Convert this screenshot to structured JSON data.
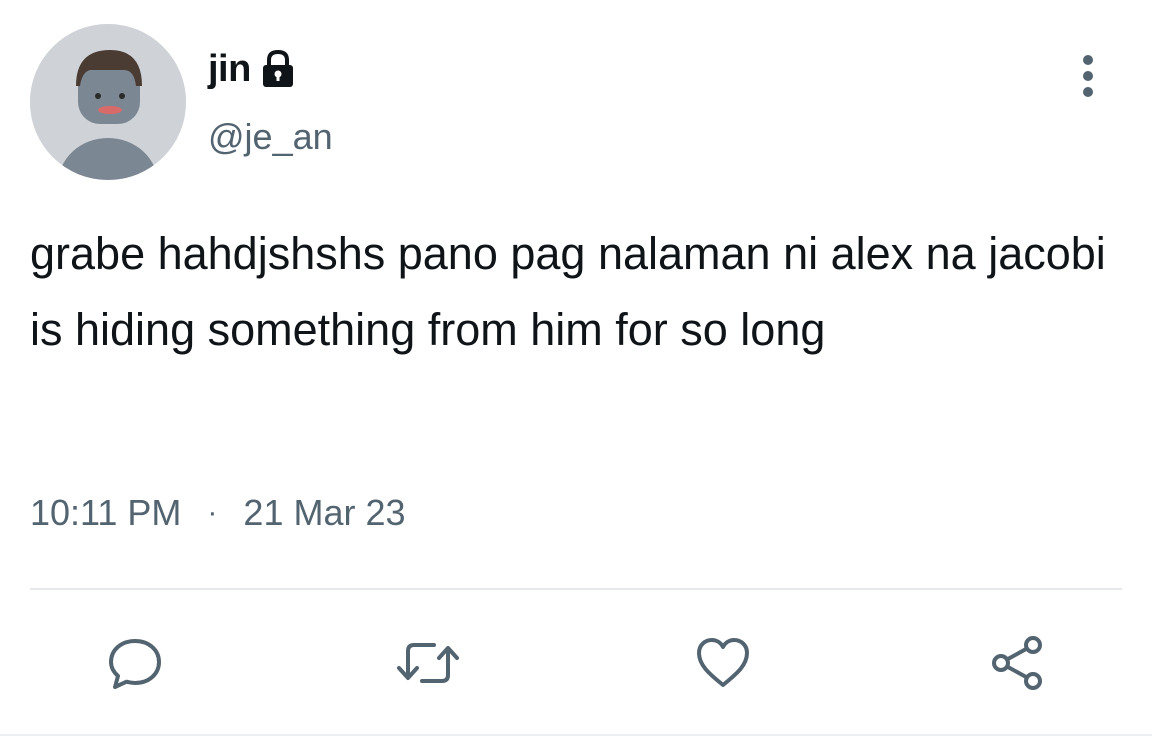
{
  "author": {
    "display_name": "jin",
    "handle": "@je_an",
    "protected_icon": "lock-icon",
    "avatar_icon": "avatar"
  },
  "tweet": {
    "text": "grabe hahdjshshs pano pag nalaman ni alex na jacobi is hiding something from him for so long",
    "time": "10:11 PM",
    "separator": "·",
    "date": "21 Mar 23"
  },
  "actions": [
    {
      "icon": "reply-icon"
    },
    {
      "icon": "retweet-icon"
    },
    {
      "icon": "like-icon"
    },
    {
      "icon": "share-icon"
    }
  ],
  "colors": {
    "text_primary": "#0f1419",
    "text_secondary": "#536471",
    "divider": "#e6e9ec",
    "avatar_bg": "#cfd3d8",
    "avatar_figure": "#7b8792"
  }
}
